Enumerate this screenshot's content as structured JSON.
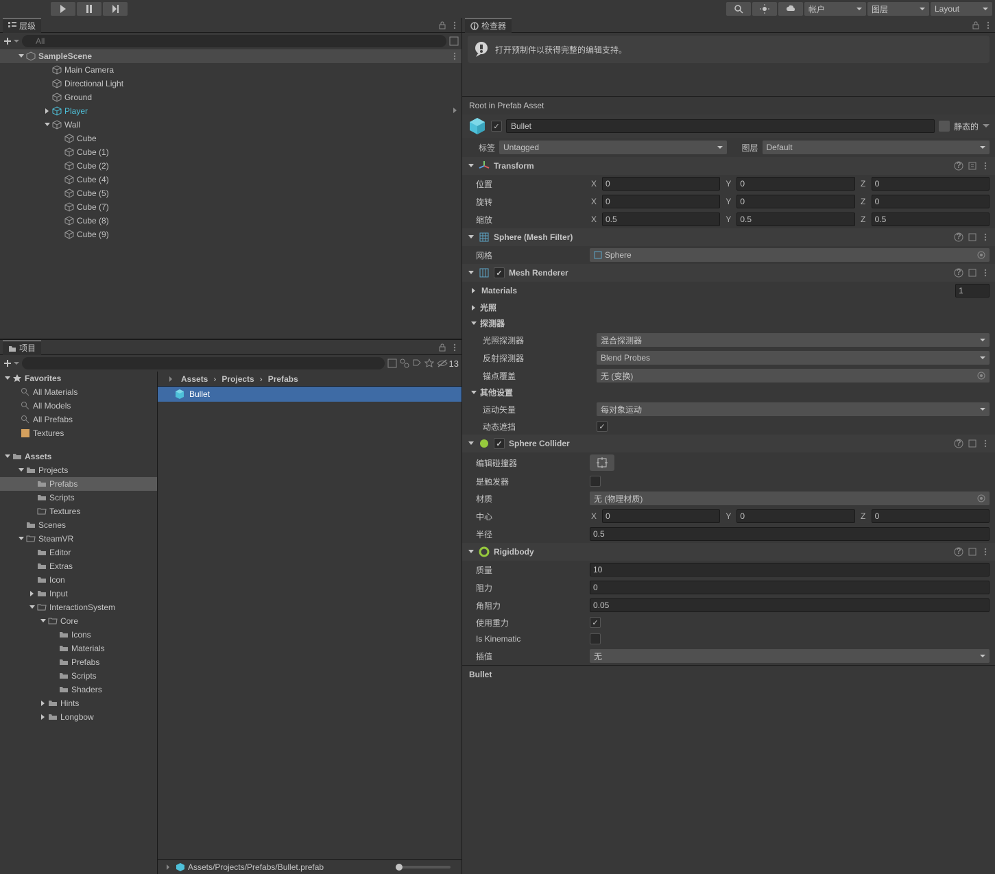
{
  "toolbar": {
    "account": "帐户",
    "layer": "图层",
    "layout": "Layout"
  },
  "hierarchy": {
    "title": "层级",
    "search_placeholder": "All",
    "scene": "SampleScene",
    "items": [
      {
        "name": "Main Camera",
        "indent": 2
      },
      {
        "name": "Directional Light",
        "indent": 2
      },
      {
        "name": "Ground",
        "indent": 2
      },
      {
        "name": "Player",
        "indent": 2,
        "player": true,
        "arrow": true
      },
      {
        "name": "Wall",
        "indent": 2,
        "arrow": true,
        "expanded": true
      },
      {
        "name": "Cube",
        "indent": 3
      },
      {
        "name": "Cube (1)",
        "indent": 3
      },
      {
        "name": "Cube (2)",
        "indent": 3
      },
      {
        "name": "Cube (4)",
        "indent": 3
      },
      {
        "name": "Cube (5)",
        "indent": 3
      },
      {
        "name": "Cube (7)",
        "indent": 3
      },
      {
        "name": "Cube (8)",
        "indent": 3
      },
      {
        "name": "Cube (9)",
        "indent": 3
      }
    ]
  },
  "project": {
    "title": "项目",
    "hidden_count": "13",
    "favorites": "Favorites",
    "fav_items": [
      "All Materials",
      "All Models",
      "All Prefabs"
    ],
    "textures": "Textures",
    "assets": "Assets",
    "tree": [
      {
        "name": "Projects",
        "indent": 1,
        "expanded": true,
        "folder": true
      },
      {
        "name": "Prefabs",
        "indent": 2,
        "folder": true,
        "selected": true
      },
      {
        "name": "Scripts",
        "indent": 2,
        "folder": true
      },
      {
        "name": "Textures",
        "indent": 2,
        "folder_o": true
      },
      {
        "name": "Scenes",
        "indent": 1,
        "folder": true
      },
      {
        "name": "SteamVR",
        "indent": 1,
        "expanded": true,
        "folder_o": true
      },
      {
        "name": "Editor",
        "indent": 2,
        "folder": true
      },
      {
        "name": "Extras",
        "indent": 2,
        "folder": true
      },
      {
        "name": "Icon",
        "indent": 2,
        "folder": true
      },
      {
        "name": "Input",
        "indent": 2,
        "arrow": true,
        "folder": true
      },
      {
        "name": "InteractionSystem",
        "indent": 2,
        "expanded": true,
        "folder_o": true
      },
      {
        "name": "Core",
        "indent": 3,
        "expanded": true,
        "folder_o": true
      },
      {
        "name": "Icons",
        "indent": 4,
        "folder": true
      },
      {
        "name": "Materials",
        "indent": 4,
        "folder": true
      },
      {
        "name": "Prefabs",
        "indent": 4,
        "folder": true
      },
      {
        "name": "Scripts",
        "indent": 4,
        "folder": true
      },
      {
        "name": "Shaders",
        "indent": 4,
        "folder": true
      },
      {
        "name": "Hints",
        "indent": 3,
        "arrow": true,
        "folder": true
      },
      {
        "name": "Longbow",
        "indent": 3,
        "arrow": true,
        "folder": true
      }
    ],
    "breadcrumb": [
      "Assets",
      "Projects",
      "Prefabs"
    ],
    "file": "Bullet",
    "status_path": "Assets/Projects/Prefabs/Bullet.prefab"
  },
  "inspector": {
    "title": "检查器",
    "banner": "打开预制件以获得完整的编辑支持。",
    "root_label": "Root in Prefab Asset",
    "name": "Bullet",
    "static_label": "静态的",
    "tag_label": "标签",
    "tag_value": "Untagged",
    "layer_label": "图层",
    "layer_value": "Default",
    "transform": {
      "title": "Transform",
      "pos": "位置",
      "rot": "旋转",
      "scale": "缩放",
      "px": "0",
      "py": "0",
      "pz": "0",
      "rx": "0",
      "ry": "0",
      "rz": "0",
      "sx": "0.5",
      "sy": "0.5",
      "sz": "0.5"
    },
    "meshfilter": {
      "title": "Sphere (Mesh Filter)",
      "mesh_label": "网格",
      "mesh_value": "Sphere"
    },
    "meshrenderer": {
      "title": "Mesh Renderer",
      "materials": "Materials",
      "materials_count": "1",
      "lighting": "光照",
      "probes": "探测器",
      "light_probe_label": "光照探测器",
      "light_probe_value": "混合探测器",
      "refl_probe_label": "反射探测器",
      "refl_probe_value": "Blend Probes",
      "anchor_label": "锚点覆盖",
      "anchor_value": "无 (变换)",
      "other": "其他设置",
      "motion_label": "运动矢量",
      "motion_value": "每对象运动",
      "dyn_occ_label": "动态遮挡"
    },
    "collider": {
      "title": "Sphere Collider",
      "edit_label": "编辑碰撞器",
      "trigger_label": "是触发器",
      "mat_label": "材质",
      "mat_value": "无 (物理材质)",
      "center_label": "中心",
      "cx": "0",
      "cy": "0",
      "cz": "0",
      "radius_label": "半径",
      "radius_value": "0.5"
    },
    "rigidbody": {
      "title": "Rigidbody",
      "mass_label": "质量",
      "mass": "10",
      "drag_label": "阻力",
      "drag": "0",
      "ang_label": "角阻力",
      "ang": "0.05",
      "gravity_label": "使用重力",
      "kinematic_label": "Is Kinematic",
      "interp_label": "插值",
      "interp_value": "无"
    },
    "footer": "Bullet"
  }
}
